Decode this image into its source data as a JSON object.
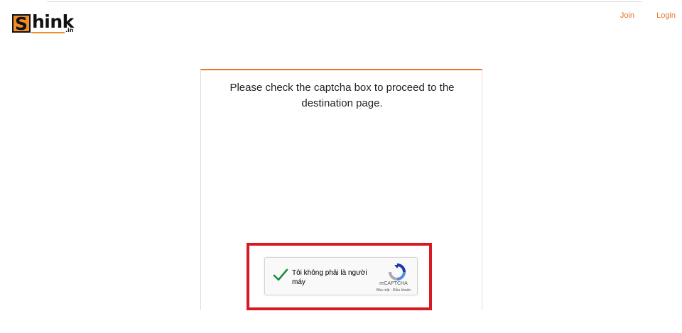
{
  "logo": {
    "letter": "S",
    "rest": "hink",
    "suffix": ".in"
  },
  "nav": {
    "join": "Join",
    "login": "Login"
  },
  "card": {
    "message": "Please check the captcha box to proceed to the destination page."
  },
  "recaptcha": {
    "label": "Tôi không phải là người máy",
    "brand": "reCAPTCHA",
    "privacy": "Bảo mật",
    "separator": " - ",
    "terms": "Điều khoản"
  },
  "colors": {
    "accent": "#f0732a",
    "highlight": "#d71921",
    "check": "#1e8e3e"
  },
  "icons": {
    "checkmark": "checkmark-icon",
    "recaptcha": "recaptcha-logo-icon"
  }
}
